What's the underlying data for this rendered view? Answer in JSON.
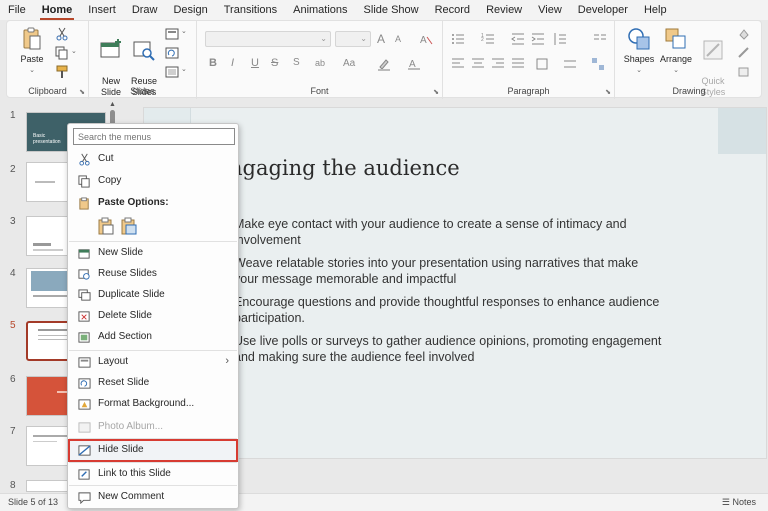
{
  "menubar": {
    "tabs": [
      "File",
      "Home",
      "Insert",
      "Draw",
      "Design",
      "Transitions",
      "Animations",
      "Slide Show",
      "Record",
      "Review",
      "View",
      "Developer",
      "Help"
    ],
    "active": "Home"
  },
  "ribbon": {
    "clipboard": {
      "label": "Clipboard",
      "paste": "Paste"
    },
    "slides": {
      "label": "Slides",
      "new_slide": "New\nSlide",
      "reuse_slides": "Reuse\nSlides"
    },
    "font": {
      "label": "Font",
      "bold": "B",
      "italic": "I",
      "underline": "U",
      "strike": "S",
      "spacing": "ab",
      "case": "Aa",
      "grow": "A",
      "shrink": "A"
    },
    "paragraph": {
      "label": "Paragraph"
    },
    "drawing": {
      "label": "Drawing",
      "shapes": "Shapes",
      "arrange": "Arrange",
      "quick_styles": "Quick\nStyles"
    }
  },
  "thumbnails": {
    "numbers": [
      "1",
      "2",
      "3",
      "4",
      "5",
      "6",
      "7",
      "8"
    ],
    "selected": "5",
    "slide1_text": "Basic\npresentation"
  },
  "slide": {
    "title": "ngaging the audience",
    "bullets": [
      "Make eye contact with your audience to create a sense of intimacy and involvement",
      "Weave relatable stories into your presentation using narratives that make your message memorable and impactful",
      "Encourage questions and provide thoughtful responses to enhance audience participation.",
      "Use live polls or surveys to gather audience opinions, promoting engagement and making sure the audience feel involved"
    ]
  },
  "context_menu": {
    "search_placeholder": "Search the menus",
    "items": {
      "cut": "Cut",
      "copy": "Copy",
      "paste_options": "Paste Options:",
      "new_slide": "New Slide",
      "reuse_slides": "Reuse Slides",
      "duplicate_slide": "Duplicate Slide",
      "delete_slide": "Delete Slide",
      "add_section": "Add Section",
      "layout": "Layout",
      "reset_slide": "Reset Slide",
      "format_background": "Format Background...",
      "photo_album": "Photo Album...",
      "hide_slide": "Hide Slide",
      "link_to_slide": "Link to this Slide",
      "new_comment": "New Comment"
    },
    "highlight_color": "#d73b32"
  },
  "status": {
    "slide_indicator": "Slide 5 of 13",
    "notes": "Notes"
  },
  "colors": {
    "accent": "#b7472a",
    "slide_bg": "#eaeff0"
  }
}
